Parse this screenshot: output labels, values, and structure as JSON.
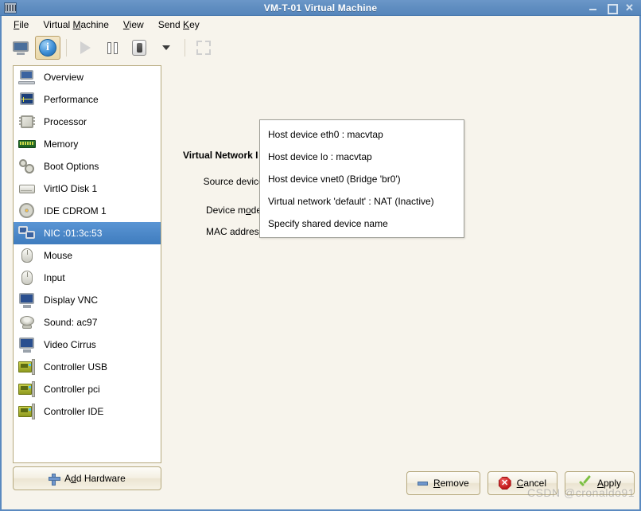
{
  "window": {
    "title": "VM-T-01 Virtual Machine",
    "app_icon": "virt-manager-icon",
    "minimize_label": "",
    "maximize_label": "",
    "close_label": "✕"
  },
  "menubar": {
    "items": [
      {
        "label": "File",
        "mnemonic": "F"
      },
      {
        "label": "Virtual Machine",
        "mnemonic": "M"
      },
      {
        "label": "View",
        "mnemonic": "V"
      },
      {
        "label": "Send Key",
        "mnemonic": "K"
      }
    ]
  },
  "toolbar": {
    "items": [
      {
        "name": "show-console-button",
        "icon": "monitor-icon",
        "active": false
      },
      {
        "name": "show-details-button",
        "icon": "info-icon",
        "active": true
      },
      {
        "name": "run-button",
        "icon": "play-icon",
        "active": false
      },
      {
        "name": "pause-button",
        "icon": "pause-icon",
        "active": false
      },
      {
        "name": "shutdown-button",
        "icon": "power-icon",
        "active": false
      },
      {
        "name": "shutdown-dropdown",
        "icon": "chevron-down-icon",
        "active": false
      },
      {
        "name": "fullscreen-button",
        "icon": "fullscreen-icon",
        "active": false
      }
    ]
  },
  "sidebar": {
    "items": [
      {
        "label": "Overview",
        "icon": "computer-icon",
        "selected": false
      },
      {
        "label": "Performance",
        "icon": "performance-icon",
        "selected": false
      },
      {
        "label": "Processor",
        "icon": "cpu-icon",
        "selected": false
      },
      {
        "label": "Memory",
        "icon": "memory-icon",
        "selected": false
      },
      {
        "label": "Boot Options",
        "icon": "gears-icon",
        "selected": false
      },
      {
        "label": "VirtIO Disk 1",
        "icon": "disk-icon",
        "selected": false
      },
      {
        "label": "IDE CDROM 1",
        "icon": "cdrom-icon",
        "selected": false
      },
      {
        "label": "NIC :01:3c:53",
        "icon": "nic-icon",
        "selected": true
      },
      {
        "label": "Mouse",
        "icon": "mouse-icon",
        "selected": false
      },
      {
        "label": "Input",
        "icon": "mouse-icon",
        "selected": false
      },
      {
        "label": "Display VNC",
        "icon": "display-icon",
        "selected": false
      },
      {
        "label": "Sound: ac97",
        "icon": "sound-icon",
        "selected": false
      },
      {
        "label": "Video Cirrus",
        "icon": "display-icon",
        "selected": false
      },
      {
        "label": "Controller USB",
        "icon": "controller-icon",
        "selected": false
      },
      {
        "label": "Controller pci",
        "icon": "controller-icon",
        "selected": false
      },
      {
        "label": "Controller IDE",
        "icon": "controller-icon",
        "selected": false
      }
    ],
    "add_hardware_label": "Add Hardware",
    "add_hardware_mnemonic": "d",
    "add_hardware_icon": "plus-icon"
  },
  "main": {
    "title": "Virtual Network I",
    "fields": {
      "source_device": "Source device:",
      "device_model": "Device m",
      "device_model_mnemonic": "o",
      "device_model_tail": "del:",
      "mac_address": "MAC address:"
    }
  },
  "popup": {
    "name": "source-device-dropdown-menu",
    "items": [
      "Host device eth0 : macvtap",
      "Host device lo : macvtap",
      "Host device vnet0 (Bridge 'br0')",
      "Virtual network 'default' : NAT (Inactive)",
      "Specify shared device name"
    ]
  },
  "buttons": {
    "remove": {
      "label": "Remove",
      "mnemonic": "R",
      "icon": "minus-icon"
    },
    "cancel": {
      "label": "Cancel",
      "mnemonic": "C",
      "icon": "cancel-icon"
    },
    "apply": {
      "label": "Apply",
      "mnemonic": "A",
      "icon": "check-icon"
    }
  },
  "watermark": "CSDN @cronaldo91",
  "colors": {
    "titlebar": "#5b8ac0",
    "window_bg": "#f7f4ec",
    "selection": "#4a86c8",
    "panel_border": "#b6a97e",
    "list_bg": "#ffffff"
  }
}
